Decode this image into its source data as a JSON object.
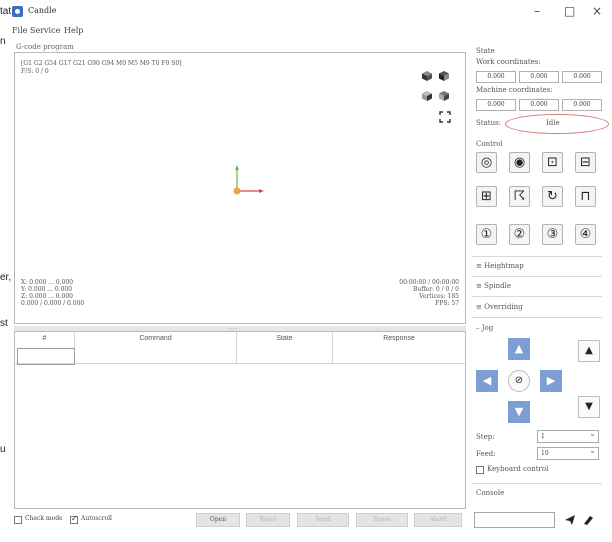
{
  "window": {
    "title": "Candle",
    "minimize_glyph": "–",
    "maximize_glyph": "□",
    "close_glyph": "×"
  },
  "bleed_text": [
    "tat",
    "n",
    "er,",
    "st",
    "u"
  ],
  "menu": [
    "File",
    "Service",
    "Help"
  ],
  "gcode_panel": {
    "title": "G-code program",
    "modal_line1": "[G1 G2 G54 G17 G21 G90 G94 M0 M5 M9 T0 F0 S0]",
    "modal_line2": "F/S: 0 / 0",
    "stats_left": [
      "X: 0.000 ... 0.000",
      "Y: 0.000 ... 0.000",
      "Z: 0.000 ... 0.000",
      "0.000 / 0.000 / 0.000"
    ],
    "stats_right": [
      "00:00:00 / 00:00:00",
      "Buffer: 0 / 0 / 0",
      "Vertices: 185",
      "FPS: 57"
    ]
  },
  "splitter_label": "......",
  "table": {
    "headers": [
      "#",
      "Command",
      "State",
      "Response"
    ]
  },
  "bottom": {
    "check_mode_label": "Check mode",
    "check_mode_checked": false,
    "autoscroll_label": "Autoscroll",
    "autoscroll_checked": true,
    "buttons": [
      "Open",
      "Reset",
      "Send",
      "Pause",
      "Abort"
    ]
  },
  "state": {
    "title": "State",
    "work_label": "Work coordinates:",
    "work": [
      "0.000",
      "0.000",
      "0.000"
    ],
    "machine_label": "Machine coordinates:",
    "machine": [
      "0.000",
      "0.000",
      "0.000"
    ],
    "status_label": "Status:",
    "status_value": "Idle"
  },
  "control": {
    "title": "Control"
  },
  "sections": {
    "heightmap": "Heightmap",
    "spindle": "Spindle",
    "overriding": "Overriding",
    "jog": "Jog",
    "console": "Console"
  },
  "jog": {
    "step_label": "Step:",
    "step_value": "1",
    "feed_label": "Feed:",
    "feed_value": "10",
    "keyboard_label": "Keyboard control",
    "keyboard_checked": false
  },
  "console_buttons": [
    "send-icon",
    "clear-icon"
  ],
  "colors": {
    "jog_blue": "#7c9ed4",
    "status_ellipse": "#d77272"
  }
}
